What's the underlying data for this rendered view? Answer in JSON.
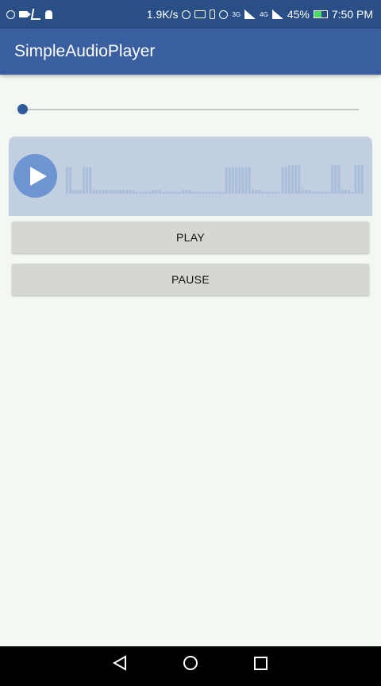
{
  "status_bar": {
    "network_speed": "1.9K/s",
    "signal_1_label": "3G",
    "signal_2_label": "4G",
    "battery": "45%",
    "time": "7:50 PM",
    "icons": [
      "whatsapp-icon",
      "video-icon",
      "usb-icon",
      "android-icon",
      "hotspot-icon",
      "cast-icon",
      "vibrate-icon",
      "alarm-icon",
      "signal-icon",
      "battery-icon"
    ]
  },
  "app_bar": {
    "title": "SimpleAudioPlayer",
    "color": "#3a5fa0"
  },
  "seekbar": {
    "progress": 0.0,
    "color": "#2f5b9c"
  },
  "audio_player": {
    "state": "paused",
    "icon": "play-icon",
    "waveform_levels": [
      0.7,
      0.7,
      0.1,
      0.1,
      0.1,
      0.7,
      0.7,
      0.7,
      0.1,
      0.1,
      0.1,
      0.1,
      0.1,
      0.1,
      0.1,
      0.1,
      0.1,
      0.1,
      0.1,
      0.1,
      0.1,
      0.05,
      0.05,
      0.05,
      0.05,
      0.05,
      0.1,
      0.1,
      0.1,
      0.05,
      0.05,
      0.05,
      0.05,
      0.05,
      0.05,
      0.1,
      0.1,
      0.1,
      0.05,
      0.05,
      0.05,
      0.05,
      0.05,
      0.05,
      0.05,
      0.05,
      0.05,
      0.05,
      0.7,
      0.7,
      0.7,
      0.7,
      0.7,
      0.7,
      0.7,
      0.7,
      0.1,
      0.1,
      0.1,
      0.05,
      0.05,
      0.05,
      0.05,
      0.05,
      0.05,
      0.7,
      0.7,
      0.75,
      0.75,
      0.75,
      0.75,
      0.1,
      0.1,
      0.1,
      0.05,
      0.05,
      0.05,
      0.05,
      0.05,
      0.05,
      0.75,
      0.75,
      0.75,
      0.1,
      0.1,
      0.1,
      0.05,
      0.75,
      0.75,
      0.75
    ],
    "colors": {
      "background": "#c2cfe0",
      "button": "#6f94d2",
      "wave": "#a9bedb"
    }
  },
  "buttons": {
    "play_label": "PLAY",
    "pause_label": "PAUSE"
  },
  "nav_bar": {
    "icons": [
      "back-icon",
      "home-icon",
      "recents-icon"
    ]
  }
}
